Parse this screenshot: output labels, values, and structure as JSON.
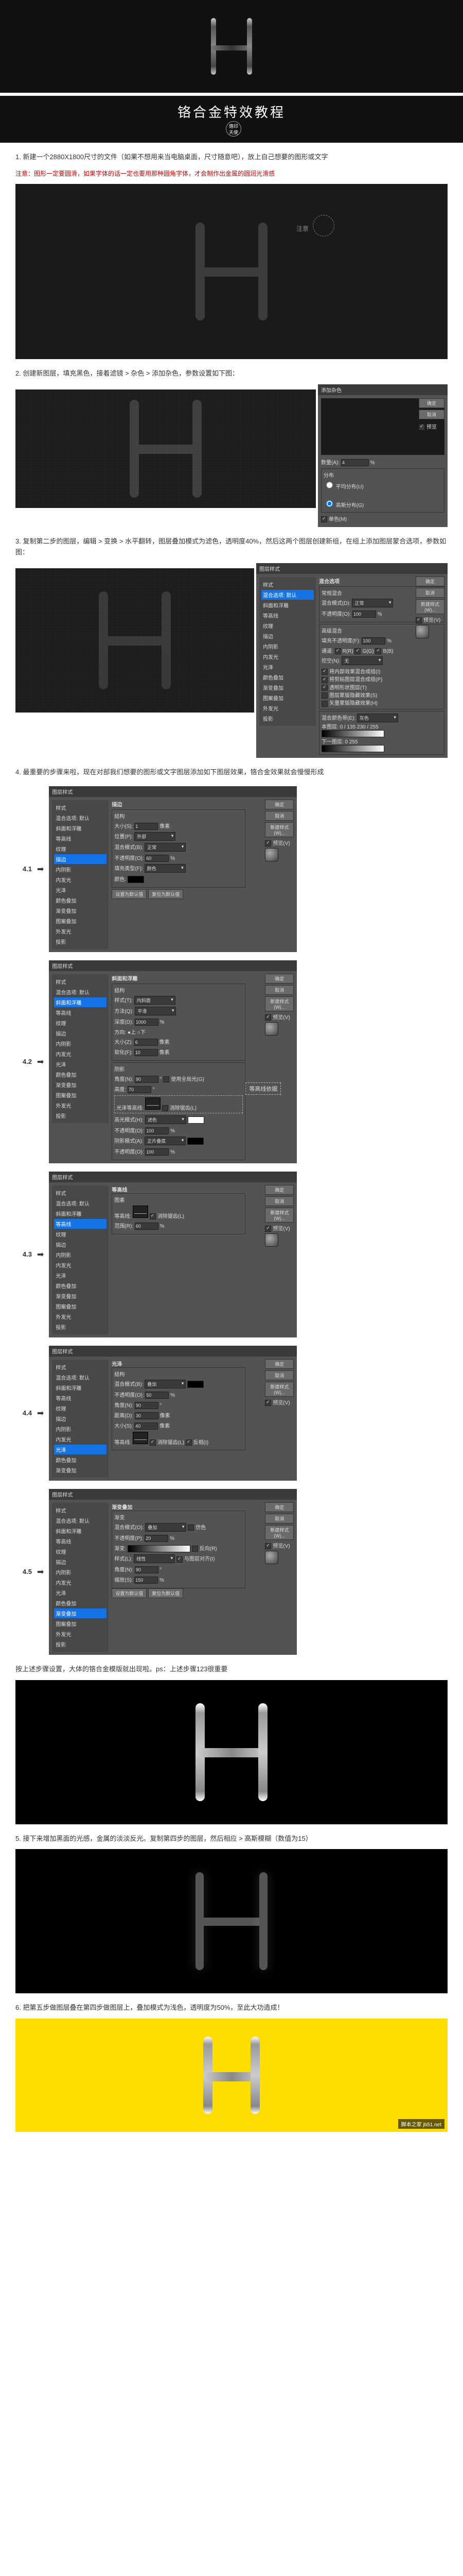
{
  "title": "铬合金特效教程",
  "badge_top": "烙印",
  "badge_bottom": "天使",
  "anno_text": "注意",
  "step1": "1. 新建一个2880X1800尺寸的文件（如果不想用来当电脑桌面，尺寸随意吧），放上自己想要的图形或文字",
  "warn": "注意：图形一定要圆滑，如果字体的话一定也要用那种圆角字体，才会制作出金属的圆润光滑感",
  "step2": "2. 创建新图层，填充黑色，接着滤镜 > 杂色 > 添加杂色，参数设置如下图：",
  "noise_dialog": {
    "title": "添加杂色",
    "ok": "确定",
    "cancel": "取消",
    "preview_cb": "预览",
    "amount_lbl": "数量(A):",
    "amount": "4",
    "pct": "%",
    "dist_lbl": "分布",
    "uniform": "平均分布(U)",
    "gaussian": "高斯分布(G)",
    "mono": "单色(M)"
  },
  "step3": "3. 复制第二步的图层，编辑 > 变换 > 水平翻转，图层叠加模式为滤色，透明度40%，然后这两个图层创建新组，在组上添加图层蒙合选项，参数如图：",
  "style_dialog": {
    "title": "图层样式",
    "ok": "确定",
    "cancel": "取消",
    "new": "新建样式(W)...",
    "preview": "预览(V)",
    "styles": "样式",
    "side": [
      "样式",
      "混合选项: 默认",
      "斜面和浮雕",
      "等高线",
      "纹理",
      "描边",
      "内阴影",
      "内发光",
      "光泽",
      "颜色叠加",
      "渐变叠加",
      "图案叠加",
      "外发光",
      "投影"
    ],
    "blend_header": "混合选项",
    "general": "常规混合",
    "mode_lbl": "混合模式(D):",
    "mode_v": "正常",
    "opacity_lbl": "不透明度(O):",
    "opacity_v": "100",
    "adv": "高级混合",
    "fill_lbl": "填充不透明度(F):",
    "fill_v": "100",
    "channels": "通道:",
    "r": "R(R)",
    "g": "G(G)",
    "b": "B(B)",
    "knockout_lbl": "挖空(N):",
    "knockout_v": "无",
    "k1": "将内部效果混合成组(I)",
    "k2": "将剪贴图层混合成组(P)",
    "k3": "透明形状图层(T)",
    "k4": "图层蒙版隐藏效果(S)",
    "k5": "矢量蒙版隐藏效果(H)",
    "blendif": "混合颜色带(E):",
    "gray": "灰色",
    "this_layer": "本图层:",
    "under": "下一图层:",
    "range1": "0 / 135   230 / 255",
    "range2": "0   255"
  },
  "step4": "4. 最重要的步骤来啦，现在对部我们想要的图形或文字图层添加如下图层效果，铬合金效果就会慢慢形成",
  "label41": "4.1",
  "label42": "4.2",
  "label43": "4.3",
  "label44": "4.4",
  "label45": "4.5",
  "stroke": {
    "header": "描边",
    "struct": "结构",
    "size_lbl": "大小(S):",
    "size": "1",
    "px": "像素",
    "pos_lbl": "位置(P):",
    "pos": "外部",
    "mode_lbl": "混合模式(B):",
    "mode": "正常",
    "opacity_lbl": "不透明度(O):",
    "opacity": "60",
    "fill_lbl": "填充类型(F):",
    "fill": "颜色",
    "color_lbl": "颜色:",
    "default": "设置为默认值",
    "reset": "复位为默认值"
  },
  "bevel": {
    "header": "斜面和浮雕",
    "struct": "结构",
    "style_lbl": "样式(T):",
    "style": "内斜面",
    "method_lbl": "方法(Q):",
    "method": "平滑",
    "depth_lbl": "深度(D):",
    "depth": "1000",
    "dir_lbl": "方向:",
    "up": "上",
    "down": "下",
    "size_lbl": "大小(Z):",
    "size": "6",
    "soft_lbl": "软化(F):",
    "soft": "10",
    "shade": "阴影",
    "angle_lbl": "角度(N):",
    "angle": "90",
    "global": "使用全局光(G)",
    "alt_lbl": "高度:",
    "alt": "70",
    "gloss_lbl": "光泽等高线:",
    "aa": "消除锯齿(L)",
    "hl_mode": "高光模式(H):",
    "hl": "滤色",
    "hl_op": "100",
    "sh_mode": "阴影模式(A):",
    "sh": "正片叠底",
    "sh_op": "100",
    "callout": "等高线依据"
  },
  "contour": {
    "header": "等高线",
    "elements": "图素",
    "contour_lbl": "等高线:",
    "aa": "消除锯齿(L)",
    "range_lbl": "范围(R):",
    "range": "60"
  },
  "satin": {
    "header": "光泽",
    "struct": "结构",
    "mode_lbl": "混合模式(B):",
    "mode": "叠加",
    "opacity_lbl": "不透明度(O):",
    "opacity": "50",
    "angle_lbl": "角度(N):",
    "angle": "90",
    "dist_lbl": "距离(D):",
    "dist": "30",
    "size_lbl": "大小(S):",
    "size": "40",
    "contour_lbl": "等高线:",
    "aa": "消除锯齿(L)",
    "invert": "反相(I)"
  },
  "gradov": {
    "header": "渐变叠加",
    "grad": "渐变",
    "mode_lbl": "混合模式(O):",
    "mode": "叠加",
    "dither": "仿色",
    "opacity_lbl": "不透明度(P):",
    "opacity": "20",
    "grad_lbl": "渐变:",
    "reverse": "反向(R)",
    "style_lbl": "样式(L):",
    "style": "线性",
    "align": "与图层对齐(I)",
    "angle_lbl": "角度(N):",
    "angle": "90",
    "scale_lbl": "缩放(S):",
    "scale": "150"
  },
  "step_after4": "按上述步骤设置，大体的铬合金模版就出现啦。ps：上述步骤123很重要",
  "step5": "5. 接下来增加黑面的光感，金属的淡淡反光。复制第四步的图层，然后相应 > 高斯模糊（数值为15）",
  "step6": "6. 把第五步做图层叠在第四步做图层上，叠加模式为浅色，透明度为50%，至此大功造成！",
  "watermark": "脚本之家 jb51.net"
}
